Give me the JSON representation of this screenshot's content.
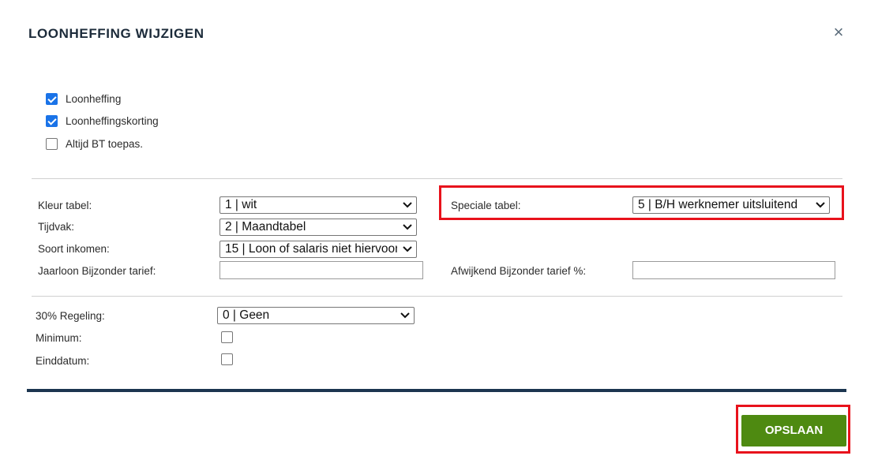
{
  "dialog": {
    "title": "LOONHEFFING WIJZIGEN",
    "close_symbol": "×"
  },
  "checkboxes": [
    {
      "label": "Loonheffing",
      "checked": true
    },
    {
      "label": "Loonheffingskorting",
      "checked": true
    },
    {
      "label": "Altijd BT toepas.",
      "checked": false
    }
  ],
  "tables": {
    "kleur_tabel": {
      "label": "Kleur tabel:",
      "value": "1 | wit"
    },
    "tijdvak": {
      "label": "Tijdvak:",
      "value": "2 | Maandtabel"
    },
    "soort_inkomen": {
      "label": "Soort inkomen:",
      "value": "15 | Loon of salaris niet hiervoor"
    },
    "jaarloon": {
      "label": "Jaarloon Bijzonder tarief:",
      "value": ""
    },
    "speciale_tabel": {
      "label": "Speciale tabel:",
      "value": "5 | B/H werknemer uitsluitend"
    },
    "afwijkend": {
      "label": "Afwijkend Bijzonder tarief %:",
      "value": ""
    }
  },
  "regeling": {
    "label": "30% Regeling:",
    "value": "0 | Geen"
  },
  "minimum": {
    "label": "Minimum:",
    "checked": false
  },
  "einddatum": {
    "label": "Einddatum:",
    "checked": false
  },
  "footer": {
    "save_label": "OPSLAAN"
  },
  "colors": {
    "accent": "#1a73e8",
    "save_button": "#4e8a11",
    "highlight": "#e8121c",
    "footer_bar": "#1c3550"
  },
  "icons": {
    "close": "close-icon",
    "dropdown": "chevron-down-icon",
    "check": "checkmark-icon"
  }
}
